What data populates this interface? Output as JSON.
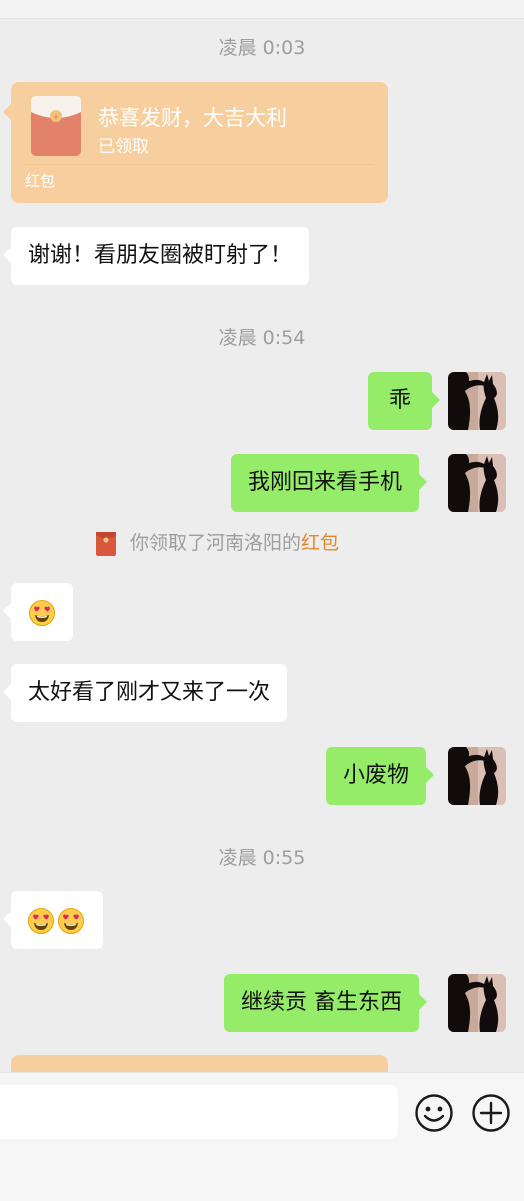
{
  "timestamps": [
    "凌晨 0:03",
    "凌晨 0:54",
    "凌晨 0:55"
  ],
  "red_packet": {
    "title": "恭喜发财，大吉大利",
    "status": "已领取",
    "label": "红包"
  },
  "messages": [
    {
      "side": "in",
      "text": "谢谢！看朋友圈被盯射了！"
    },
    {
      "side": "out",
      "text": "乖"
    },
    {
      "side": "out",
      "text": "我刚回来看手机"
    },
    {
      "side": "in",
      "emoji": "heart-eyes-face",
      "count": 1
    },
    {
      "side": "in",
      "text": "太好看了刚才又来了一次"
    },
    {
      "side": "out",
      "text": "小废物"
    },
    {
      "side": "in",
      "emoji": "heart-eyes-face",
      "count": 2
    },
    {
      "side": "out",
      "text": "继续贡 畜生东西"
    }
  ],
  "system_notice": {
    "prefix": "你领取了河南洛阳的",
    "link": "红包"
  },
  "input_bar": {
    "emoji_button_icon": "smiley-icon",
    "more_button_icon": "plus-circle-icon"
  },
  "colors": {
    "background": "#ededed",
    "outgoing_bubble": "#95ec69",
    "incoming_bubble": "#ffffff",
    "red_packet": "#f7cf9f",
    "link": "#e6862a"
  }
}
